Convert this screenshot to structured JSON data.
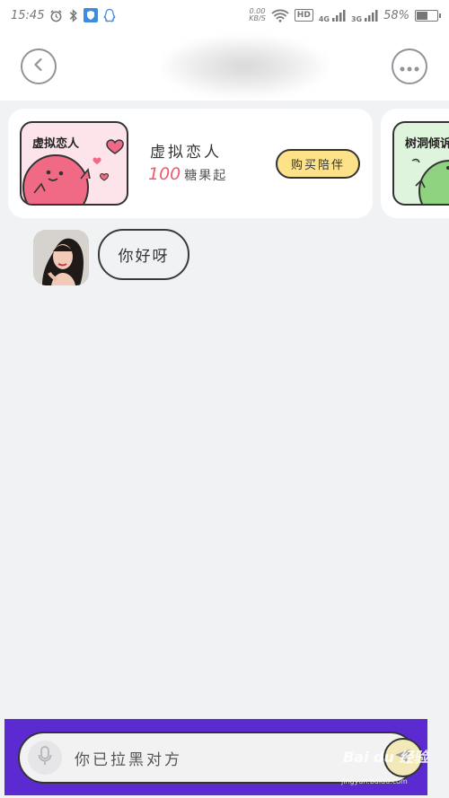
{
  "status_bar": {
    "time": "15:45",
    "net_speed_value": "0.00",
    "net_speed_unit": "KB/S",
    "hd": "HD",
    "sig1": "4G",
    "sig2": "3G",
    "battery": "58%",
    "battery_level": 0.58
  },
  "header": {
    "back_icon": "chevron-left-icon",
    "more_icon": "ellipsis-icon"
  },
  "promo": {
    "primary": {
      "thumb_label": "虚拟恋人",
      "title": "虚拟恋人",
      "price_num": "100",
      "price_suffix": "糖果起",
      "button": "购买陪伴",
      "accent": "#ef5a6d",
      "button_color": "#fde28a"
    },
    "secondary": {
      "thumb_label": "树洞倾诉"
    }
  },
  "chat": {
    "messages": [
      {
        "text": "你好呀"
      }
    ]
  },
  "input": {
    "placeholder": "你已拉黑对方",
    "frame_color": "#5b2ad1"
  },
  "watermark": {
    "brand": "Bai du 经验",
    "url": "jingyan.baidu.com"
  }
}
